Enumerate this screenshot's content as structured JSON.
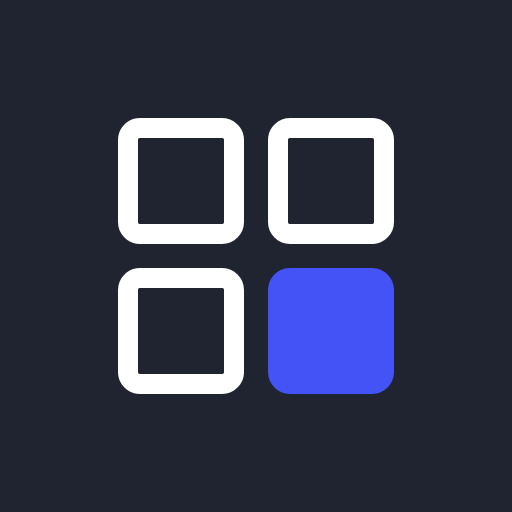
{
  "icon": {
    "name": "grid-apps-icon",
    "background_color": "#1f2430",
    "outline_color": "#ffffff",
    "accent_color": "#4353f6",
    "tiles": [
      {
        "name": "tile-top-left",
        "style": "outline"
      },
      {
        "name": "tile-top-right",
        "style": "outline"
      },
      {
        "name": "tile-bottom-left",
        "style": "outline"
      },
      {
        "name": "tile-bottom-right",
        "style": "filled"
      }
    ]
  }
}
